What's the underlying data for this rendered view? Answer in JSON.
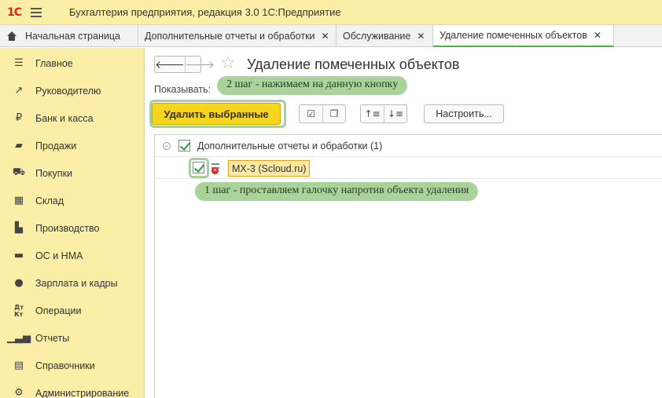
{
  "app": {
    "logo": "1С",
    "title": "Бухгалтерия предприятия, редакция 3.0 1С:Предприятие"
  },
  "tabs": [
    {
      "label": "Начальная страница",
      "icon": "home-icon"
    },
    {
      "label": "Дополнительные отчеты и обработки",
      "closable": true
    },
    {
      "label": "Обслуживание",
      "closable": true
    },
    {
      "label": "Удаление помеченных объектов",
      "closable": true,
      "active": true
    }
  ],
  "sidebar": {
    "items": [
      {
        "label": "Главное",
        "icon": "list-icon"
      },
      {
        "label": "Руководителю",
        "icon": "trend-icon"
      },
      {
        "label": "Банк и касса",
        "icon": "ruble-icon"
      },
      {
        "label": "Продажи",
        "icon": "bag-icon"
      },
      {
        "label": "Покупки",
        "icon": "cart-icon"
      },
      {
        "label": "Склад",
        "icon": "warehouse-icon"
      },
      {
        "label": "Производство",
        "icon": "factory-icon"
      },
      {
        "label": "ОС и НМА",
        "icon": "truck-icon"
      },
      {
        "label": "Зарплата и кадры",
        "icon": "person-icon"
      },
      {
        "label": "Операции",
        "icon": "dt-kt-icon"
      },
      {
        "label": "Отчеты",
        "icon": "chart-icon"
      },
      {
        "label": "Справочники",
        "icon": "book-icon"
      },
      {
        "label": "Администрирование",
        "icon": "gear-icon"
      }
    ]
  },
  "main": {
    "title": "Удаление помеченных объектов",
    "show_label": "Показывать:",
    "delete_button": "Удалить выбранные",
    "setup_button": "Настроить...",
    "hint_step2": "2 шаг - нажимаем на данную кнопку",
    "hint_step1": "1 шаг - проставляем галочку напротив объекта удаления",
    "tree": {
      "group_label": "Дополнительные отчеты и обработки (1)",
      "item_label": "МХ-3 (Scloud.ru)"
    }
  },
  "colors": {
    "panel": "#fbeea6",
    "button_primary": "#f7d51d",
    "hint_bg": "#a9d39a",
    "active_tab_underline": "#4caf50"
  }
}
